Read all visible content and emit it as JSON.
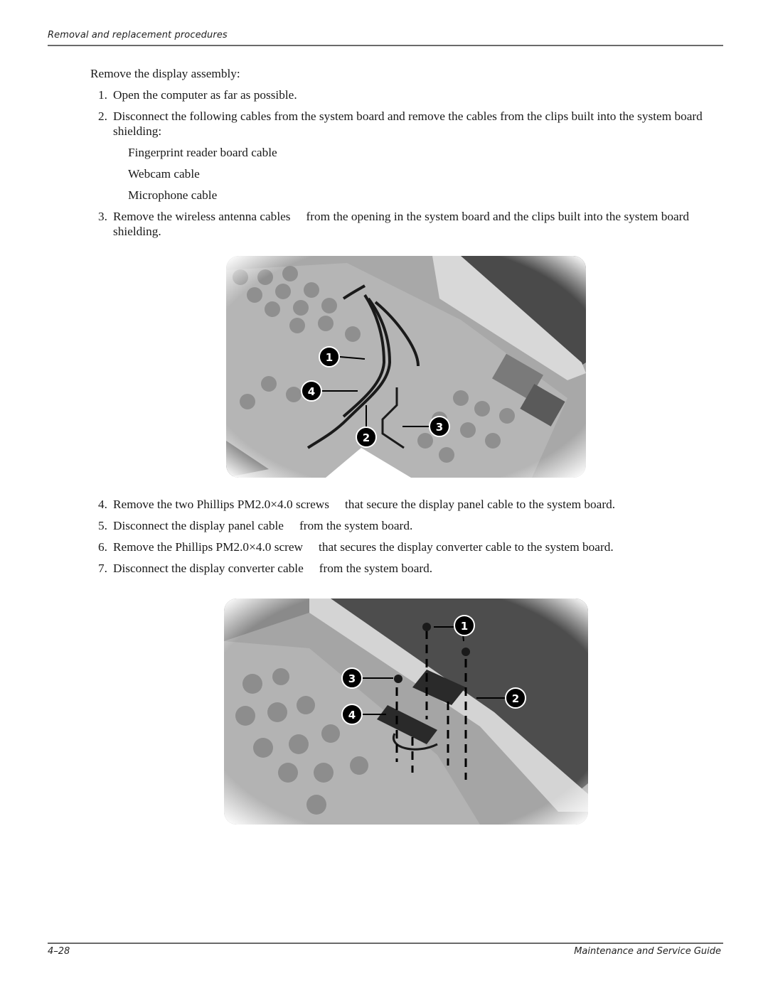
{
  "header": {
    "running_head": "Removal and replacement procedures"
  },
  "intro": "Remove the display assembly:",
  "steps_part1": [
    {
      "num": "1.",
      "text": "Open the computer as far as possible."
    },
    {
      "num": "2.",
      "text": "Disconnect the following cables from the system board and remove the cables from the clips built into the system board shielding:"
    }
  ],
  "cable_list": [
    "Fingerprint reader board cable",
    "Webcam cable",
    "Microphone cable"
  ],
  "step3": {
    "num": "3.",
    "text_before": "Remove the wireless antenna cables",
    "text_after": "from the opening in the system board and the clips built into the system board shielding."
  },
  "figure1": {
    "description": "Photo of system board with cables routed through clips",
    "callouts": [
      "1",
      "2",
      "3",
      "4"
    ]
  },
  "steps_part2": [
    {
      "num": "4.",
      "before": "Remove the two Phillips PM2.0×4.0 screws",
      "after": "that secure the display panel cable to the system board."
    },
    {
      "num": "5.",
      "before": "Disconnect the display panel cable",
      "after": "from the system board."
    },
    {
      "num": "6.",
      "before": "Remove the Phillips PM2.0×4.0 screw",
      "after": "that secures the display converter cable to the system board."
    },
    {
      "num": "7.",
      "before": "Disconnect the display converter cable",
      "after": "from the system board."
    }
  ],
  "figure2": {
    "description": "Photo of display panel cable and display converter cable with screws removed",
    "callouts": [
      "1",
      "2",
      "3",
      "4"
    ]
  },
  "footer": {
    "page_number": "4–28",
    "guide_title": "Maintenance and Service Guide"
  }
}
